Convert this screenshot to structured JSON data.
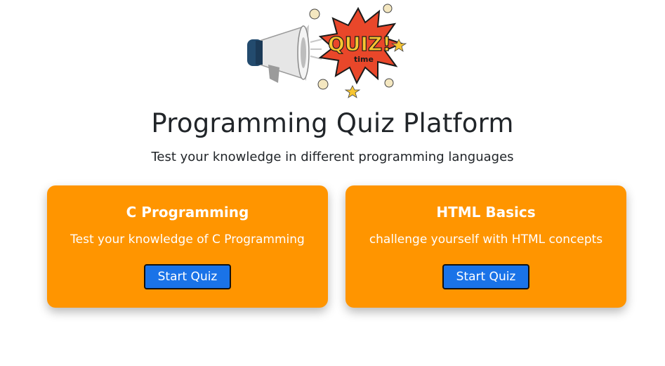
{
  "header": {
    "image_icon": "megaphone-quiz-time-illustration",
    "image_text_main": "QUIZ!",
    "image_text_sub": "time",
    "title": "Programming Quiz Platform",
    "subtitle": "Test your knowledge in different programming languages"
  },
  "cards": [
    {
      "title": "C Programming",
      "description": "Test your knowledge of C Programming",
      "button_label": "Start Quiz"
    },
    {
      "title": "HTML Basics",
      "description": "challenge yourself with HTML concepts",
      "button_label": "Start Quiz"
    }
  ],
  "colors": {
    "card_background": "#ff9500",
    "button_background": "#1a73e8",
    "title_text": "#212529"
  }
}
